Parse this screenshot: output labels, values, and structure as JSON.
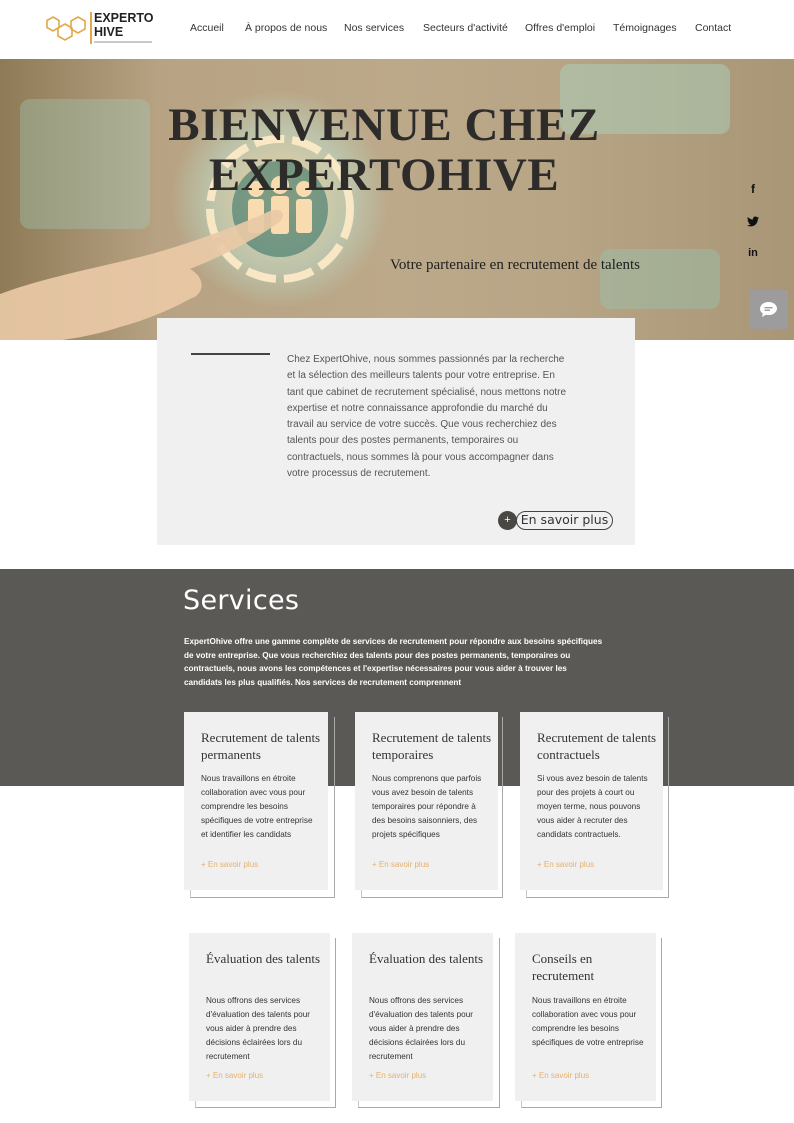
{
  "brand": {
    "name_line1": "EXPERTO",
    "name_line2": "HIVE",
    "accent_color": "#e1a84a"
  },
  "nav": {
    "items": [
      {
        "label": "Accueil"
      },
      {
        "label": "À propos de nous"
      },
      {
        "label": "Nos services"
      },
      {
        "label": "Secteurs d'activité"
      },
      {
        "label": "Offres d'emploi"
      },
      {
        "label": "Témoignages"
      },
      {
        "label": "Contact"
      }
    ]
  },
  "hero": {
    "title_line1": "BIENVENUE CHEZ",
    "title_line2": "EXPERTOHIVE",
    "subtitle": "Votre partenaire en recrutement de talents"
  },
  "social": {
    "facebook": "f",
    "twitter_icon": "twitter-icon",
    "linkedin": "in"
  },
  "about": {
    "text": "Chez ExpertOhive, nous sommes passionnés par la recherche et la sélection des meilleurs talents pour votre entreprise. En tant que cabinet de recrutement spécialisé, nous mettons notre expertise et notre connaissance approfondie du marché du travail au service de votre succès. Que vous recherchiez des talents pour des postes permanents, temporaires ou contractuels, nous sommes là pour vous accompagner dans votre processus de recrutement.",
    "button_plus": "+",
    "button_label": "En savoir plus"
  },
  "services": {
    "title": "Services",
    "intro": "ExpertOhive offre une gamme complète de services de recrutement pour répondre aux besoins spécifiques de votre entreprise. Que vous recherchiez des talents pour des postes permanents, temporaires ou contractuels, nous avons les compétences et l'expertise nécessaires pour vous aider à trouver les candidats les plus qualifiés. Nos services de recrutement comprennent",
    "background_color": "#5a5955",
    "cards": [
      {
        "title": "Recrutement de talents permanents",
        "text": "Nous travaillons en étroite collaboration avec vous pour comprendre les besoins spécifiques de votre entreprise et identifier les candidats",
        "link": "+ En savoir plus"
      },
      {
        "title": "Recrutement de talents temporaires",
        "text": "Nous comprenons que parfois vous avez besoin de talents temporaires pour répondre à des besoins saisonniers, des projets spécifiques",
        "link": "+ En savoir plus"
      },
      {
        "title": "Recrutement de talents contractuels",
        "text": "Si vous avez besoin de talents pour des projets à court ou moyen terme, nous pouvons vous aider à recruter des candidats contractuels.",
        "link": "+ En savoir plus"
      },
      {
        "title": "Évaluation des talents",
        "text": "Nous offrons des services d'évaluation des talents pour vous aider à prendre des décisions éclairées lors du recrutement",
        "link": "+ En savoir plus"
      },
      {
        "title": "Évaluation des talents",
        "text": "Nous offrons des services d'évaluation des talents pour vous aider à prendre des décisions éclairées lors du recrutement",
        "link": "+ En savoir plus"
      },
      {
        "title": "Conseils en recrutement",
        "text": "Nous travaillons en étroite collaboration avec vous pour comprendre les besoins spécifiques de votre entreprise",
        "link": "+ En savoir plus"
      }
    ]
  }
}
